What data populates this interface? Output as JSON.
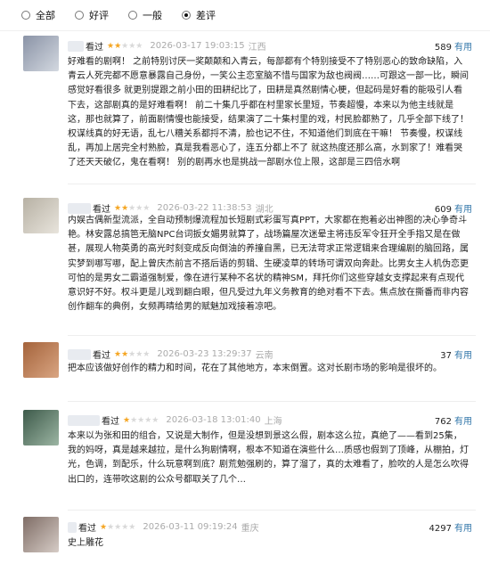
{
  "filters": [
    {
      "label": "全部",
      "selected": false
    },
    {
      "label": "好评",
      "selected": false
    },
    {
      "label": "一般",
      "selected": false
    },
    {
      "label": "差评",
      "selected": true
    }
  ],
  "reviews": [
    {
      "action": "看过",
      "rating": 2,
      "date": "2026-03-17 19:03:15",
      "location": "江西",
      "votes": "589",
      "useful_label": "有用",
      "content": "好难看的剧啊！ 之前特别讨厌一奖颠颠和入青云，每部都有个特别接受不了特别恶心的致命缺陷，入青云人死完都不愿意暴露自己身份，一笑公主恋室脑不惜与国家为敌也阀阀……可跟这一部一比，瞬间感觉好看很多 就更别提跟之前小田的田耕纪比了，田耕是真然剧情心梗，但起码是好看的能吸引人看下去，这部剧真的是好难看啊！ 前二十集几乎都在村里家长里短，节奏超慢，本来以为他主线就是这，那也就算了，前面剧情慢也能接受，结果演了二十集村里的戏，村民脸都熟了，几乎全部下线了！ 权谋线真的好无语，乱七八糟关系都捋不清，脸也记不住，不知道他们到底在干嘛！ 节奏慢，权谋线乱，再加上居完全村熟脸，真是我看恶心了，连五分都上不了 就这热度还那么高，水到家了！难看哭了还天天破亿，鬼在看啊！ 别的剧再水也是挑战一部剧水位上限，这部是三四倍水啊"
    },
    {
      "action": "看过",
      "rating": 2,
      "date": "2026-03-22 11:38:53",
      "location": "湖北",
      "votes": "609",
      "useful_label": "有用",
      "content": "内娱古偶新型流派，全自动预制爆流程加长短剧式彩蛋写真PPT，大家都在抱着必出神图的决心争奇斗艳。林安露总搞笆无脑NPC台词扳女媚男就算了，战场篇屋次迷晕主将违反军令狂开全手指又是在做甚，展现人物英勇的高光时刻变成反向倒油的养撞自黑，已无法苛求正常逻辑来合理编剧的脑回路，属实梦到哪写哪，配上曾庆杰前言不搭后语的剪辑、生硬凌草的转场可谓双向奔赴。比男女主人机伪恋更可怕的是男女二霸道强制爱，像在进行某种不名状的精神SM，拜托你们这些穿越女支撑起来有点现代意识好不好。权斗更是儿戏到翻白眼，但凡受过九年义务教育的绝对看不下去。焦点放在撕番而非内容创作翻车的典例，女频再晴给男的赋魅加戏接着凉吧。"
    },
    {
      "action": "看过",
      "rating": 2,
      "date": "2026-03-23 13:29:37",
      "location": "云南",
      "votes": "37",
      "useful_label": "有用",
      "content": "把本应该做好创作的精力和时间，花在了其他地方，本末倒置。这对长剧市场的影响是很坏的。"
    },
    {
      "action": "看过",
      "rating": 1,
      "date": "2026-03-18 13:01:40",
      "location": "上海",
      "votes": "762",
      "useful_label": "有用",
      "content": "本来以为张和田的组合，又说是大制作，但是没想到景这么假，剧本这么拉，真绝了——看到25集，我的妈呀，真是越来越拉，是什么狗剧情啊，根本不知道在演些什么…质感也假到了顶峰，从棚拍，灯光，色调，到配乐，什么玩意啊到底？剧荒勉强刷的，算了溜了，真的太难看了，脸吹的人是怎么吹得出口的，连带吹这剧的公众号都取关了几个…"
    },
    {
      "action": "看过",
      "rating": 1,
      "date": "2026-03-11 09:19:24",
      "location": "重庆",
      "votes": "4297",
      "useful_label": "有用",
      "content": "史上雕花"
    }
  ]
}
